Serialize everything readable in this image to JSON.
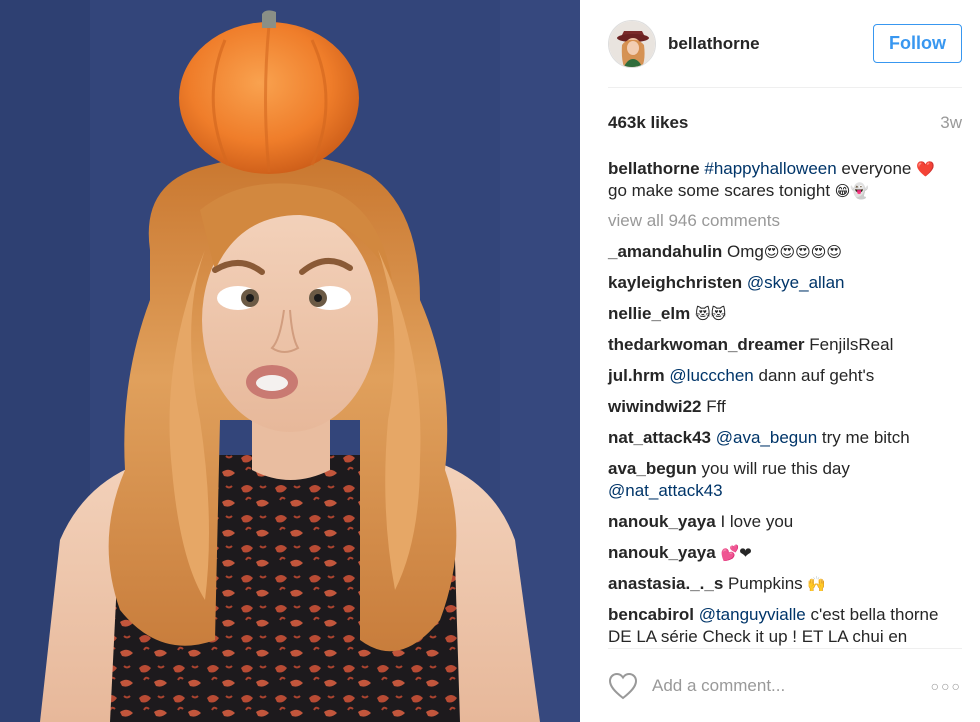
{
  "header": {
    "username": "bellathorne",
    "follow_label": "Follow"
  },
  "stats": {
    "likes": "463k likes",
    "age": "3w"
  },
  "caption": {
    "user": "bellathorne",
    "hashtag": "#happyhalloween",
    "text_1": " everyone ",
    "emoji_1": "❤️",
    "text_2": "go make some scares tonight ",
    "emoji_2": "😁👻"
  },
  "view_all": "view all 946 comments",
  "comments": [
    {
      "user": "_amandahulin",
      "parts": [
        {
          "t": " Omg"
        },
        {
          "t": "😍😍😍😍😍",
          "emoji": true
        }
      ]
    },
    {
      "user": "kayleighchristen",
      "parts": [
        {
          "t": " "
        },
        {
          "t": "@skye_allan",
          "mention": true
        }
      ]
    },
    {
      "user": "nellie_elm",
      "parts": [
        {
          "t": " "
        },
        {
          "t": "😻😻",
          "emoji": true
        }
      ]
    },
    {
      "user": "thedarkwoman_dreamer",
      "parts": [
        {
          "t": " FenjilsReal"
        }
      ]
    },
    {
      "user": "jul.hrm",
      "parts": [
        {
          "t": " "
        },
        {
          "t": "@luccchen",
          "mention": true
        },
        {
          "t": " dann auf geht's"
        }
      ]
    },
    {
      "user": "wiwindwi22",
      "parts": [
        {
          "t": " Fff"
        }
      ]
    },
    {
      "user": "nat_attack43",
      "parts": [
        {
          "t": " "
        },
        {
          "t": "@ava_begun",
          "mention": true
        },
        {
          "t": " try me bitch"
        }
      ]
    },
    {
      "user": "ava_begun",
      "parts": [
        {
          "t": " you will rue this day "
        },
        {
          "t": "@nat_attack43",
          "mention": true
        }
      ]
    },
    {
      "user": "nanouk_yaya",
      "parts": [
        {
          "t": " I love you"
        }
      ]
    },
    {
      "user": "nanouk_yaya",
      "parts": [
        {
          "t": " "
        },
        {
          "t": "💕❤",
          "emoji": true
        }
      ]
    },
    {
      "user": "anastasia._._s",
      "parts": [
        {
          "t": " Pumpkins "
        },
        {
          "t": "🙌",
          "emoji": true
        }
      ]
    },
    {
      "user": "bencabirol",
      "parts": [
        {
          "t": " "
        },
        {
          "t": "@tanguyvialle",
          "mention": true
        },
        {
          "t": " c'est bella thorne DE LA série Check it up ! ET LA chui en"
        }
      ]
    }
  ],
  "footer": {
    "add_comment_placeholder": "Add a comment...",
    "more_label": "○○○"
  },
  "colors": {
    "accent": "#3897f0",
    "mention": "#003569",
    "muted": "#999999",
    "photo_bg": "#33457a",
    "pumpkin": "#f0842e",
    "hair": "#d98c4a"
  },
  "icons": [
    "heart-icon",
    "more-options-icon"
  ]
}
